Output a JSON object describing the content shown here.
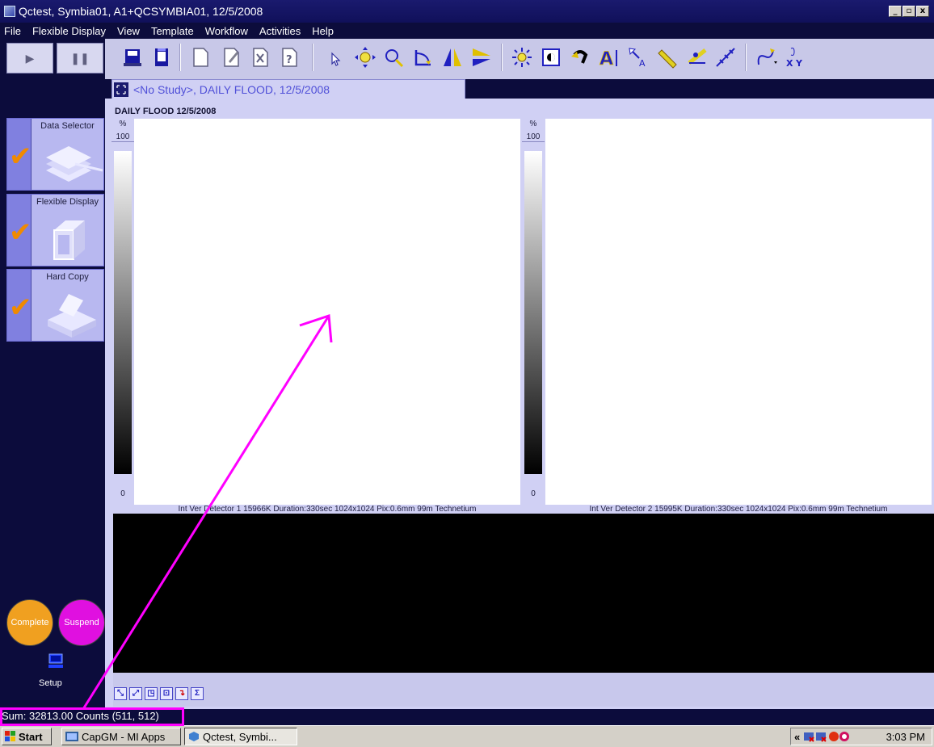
{
  "window": {
    "title": "Qctest, Symbia01, A1+QCSYMBIA01, 12/5/2008",
    "controls": [
      "_",
      "▫",
      "x"
    ]
  },
  "menu": [
    "File",
    "Flexible Display",
    "View",
    "Template",
    "Workflow",
    "Activities",
    "Help"
  ],
  "toolbar": {
    "icons": [
      "save-icon",
      "copy-icon",
      "new-page-icon",
      "edit-page-icon",
      "delete-page-icon",
      "help-page-icon",
      "pointer-icon",
      "move-icon",
      "zoom-icon",
      "rotate-icon",
      "flip-horizontal-icon",
      "flip-vertical-icon",
      "brightness-icon",
      "contrast-icon",
      "undo-icon",
      "text-annotation-icon",
      "arrow-annotation-icon",
      "ruler-icon",
      "angle-icon",
      "profile-icon",
      "freehand-icon",
      "xy-icon"
    ]
  },
  "sidebar": {
    "items": [
      {
        "label": "Data Selector",
        "checked": true
      },
      {
        "label": "Flexible Display",
        "checked": true
      },
      {
        "label": "Hard Copy",
        "checked": true
      }
    ],
    "complete_label": "Complete",
    "suspend_label": "Suspend",
    "setup_label": "Setup"
  },
  "tab": {
    "label": "<No Study>, DAILY FLOOD, 12/5/2008"
  },
  "view": {
    "title": "DAILY FLOOD 12/5/2008",
    "panels": [
      {
        "scale_unit": "%",
        "scale_max": "100",
        "scale_min": "0",
        "caption": "Int Ver Detector 1 15966K Duration:330sec 1024x1024 Pix:0.6mm 99m Technetium"
      },
      {
        "scale_unit": "%",
        "scale_max": "100",
        "scale_min": "0",
        "caption": "Int Ver Detector 2 15995K Duration:330sec 1024x1024 Pix:0.6mm 99m Technetium"
      }
    ]
  },
  "bottom_tools": [
    "⤡",
    "⤢",
    "◳",
    "⊡",
    "↴",
    "Σ"
  ],
  "status": {
    "text": "Sum: 32813.00 Counts (511, 512)"
  },
  "taskbar": {
    "start_label": "Start",
    "tasks": [
      {
        "label": "CapGM - MI Apps",
        "active": false
      },
      {
        "label": "Qctest, Symbi...",
        "active": true
      }
    ],
    "tray_chevron": "«",
    "clock": "3:03 PM"
  },
  "colors": {
    "background": "#0c0c3c",
    "panel": "#d0d0f4",
    "accent_check": "#f08a00",
    "complete": "#f0a020",
    "suspend": "#e010e0",
    "annotation": "#ff00ff"
  }
}
